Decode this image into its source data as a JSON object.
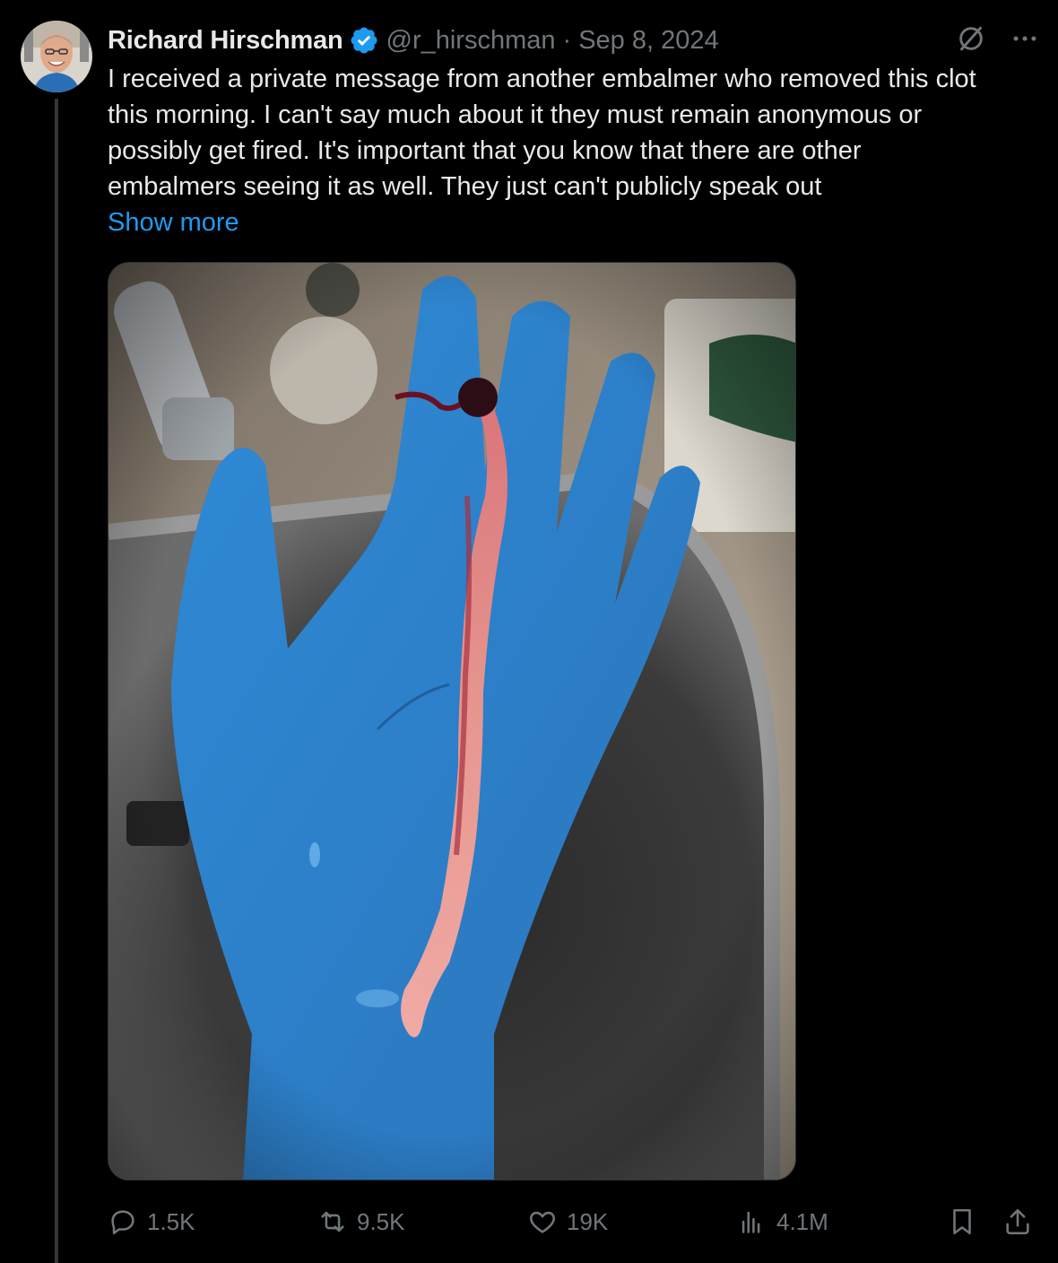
{
  "post": {
    "author": {
      "name": "Richard Hirschman",
      "handle": "@r_hirschman",
      "verified": true,
      "avatar_icon": "profile-photo"
    },
    "separator": "·",
    "date": "Sep 8, 2024",
    "text_lines": [
      "I received a private message from another embalmer who removed this clot",
      "this morning. I can't say much about it they must remain anonymous or",
      "possibly get fired. It's important that you know that there are other",
      "embalmers seeing it as well. They just can't publicly speak out"
    ],
    "show_more_label": "Show more",
    "media_icon": "photo-blue-gloved-hand-holding-clot",
    "top_icons": [
      "grok-icon",
      "more-options-icon"
    ]
  },
  "actions": {
    "replies": "1.5K",
    "reposts": "9.5K",
    "likes": "19K",
    "views": "4.1M",
    "bookmark_icon": "bookmark-icon",
    "share_icon": "share-icon"
  },
  "colors": {
    "background": "#000000",
    "text": "#e7e9ea",
    "secondary": "#71767b",
    "link": "#1d9bf0",
    "verified": "#1d9bf0"
  }
}
